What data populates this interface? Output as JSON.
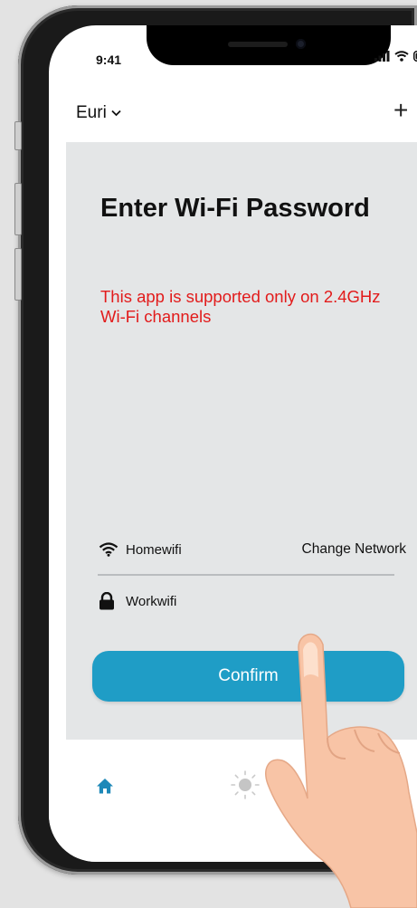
{
  "status_bar": {
    "time": "9:41"
  },
  "header": {
    "home_name": "Euri",
    "add_icon": "plus-icon"
  },
  "content": {
    "title": "Enter Wi-Fi Password",
    "warning": "This app is supported only on 2.4GHz Wi-Fi channels",
    "current_network": {
      "name": "Homewifi",
      "icon": "wifi-icon"
    },
    "change_network_label": "Change Network",
    "other_network": {
      "name": "Workwifi",
      "icon": "lock-icon"
    },
    "confirm_label": "Confirm"
  },
  "tabbar": {
    "items": [
      {
        "icon": "home-icon"
      },
      {
        "icon": "light-icon"
      }
    ]
  },
  "colors": {
    "accent": "#1f9dc6",
    "warning": "#e21b1b",
    "panel": "#e4e6e7",
    "background": "#e3e3e3"
  }
}
